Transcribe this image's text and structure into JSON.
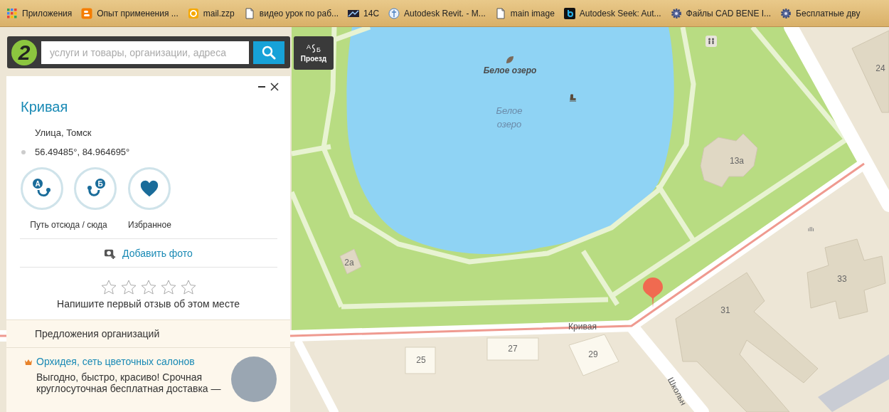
{
  "bookmarks": [
    {
      "kind": "apps",
      "label": "Приложения"
    },
    {
      "kind": "blog",
      "label": "Опыт применения ..."
    },
    {
      "kind": "mail",
      "label": "mail.zzp"
    },
    {
      "kind": "page",
      "label": "видео урок по раб..."
    },
    {
      "kind": "image",
      "label": "14C"
    },
    {
      "kind": "globe",
      "label": "Autodesk Revit. - M..."
    },
    {
      "kind": "page",
      "label": "main image"
    },
    {
      "kind": "square",
      "label": "Autodesk Seek: Aut..."
    },
    {
      "kind": "gear",
      "label": "Файлы CAD BENE I..."
    },
    {
      "kind": "gear",
      "label": "Бесплатные дву"
    }
  ],
  "search": {
    "logo": "2",
    "placeholder": "услуги и товары, организации, адреса"
  },
  "route_button": {
    "letters": [
      "А",
      "Б"
    ],
    "label": "Проезд"
  },
  "map": {
    "labels": [
      {
        "kind": "poi",
        "text": "Белое озеро"
      },
      {
        "kind": "water",
        "text": "Белое озеро"
      },
      {
        "kind": "house",
        "text": "13а"
      },
      {
        "kind": "house",
        "text": "24"
      },
      {
        "kind": "house",
        "text": "2а"
      },
      {
        "kind": "house",
        "text": "33"
      },
      {
        "kind": "house",
        "text": "31"
      },
      {
        "kind": "house",
        "text": "25"
      },
      {
        "kind": "house",
        "text": "27"
      },
      {
        "kind": "house",
        "text": "29"
      },
      {
        "kind": "street",
        "text": "Кривая"
      },
      {
        "kind": "street_vertical",
        "text": "Школьн"
      }
    ]
  },
  "panel": {
    "title": "Кривая",
    "subtitle": "Улица, Томск",
    "coordinates": "56.49485°, 84.964695°",
    "action_groups": [
      {
        "label": "Путь отсюда / сюда",
        "buttons": [
          {
            "kind": "route_from",
            "letter": "А"
          },
          {
            "kind": "route_to",
            "letter": "Б"
          }
        ]
      },
      {
        "label": "Избранное",
        "buttons": [
          {
            "kind": "favorite"
          }
        ]
      }
    ],
    "add_photo": "Добавить фото",
    "rating": {
      "stars": 0,
      "prompt": "Напишите первый отзыв об этом месте"
    },
    "offers": {
      "title": "Предложения организаций",
      "items": [
        {
          "name": "Орхидея, сеть цветочных салонов",
          "text": "Выгодно, быстро, красиво! Срочная круглосуточная бесплатная доставка —"
        }
      ]
    }
  }
}
